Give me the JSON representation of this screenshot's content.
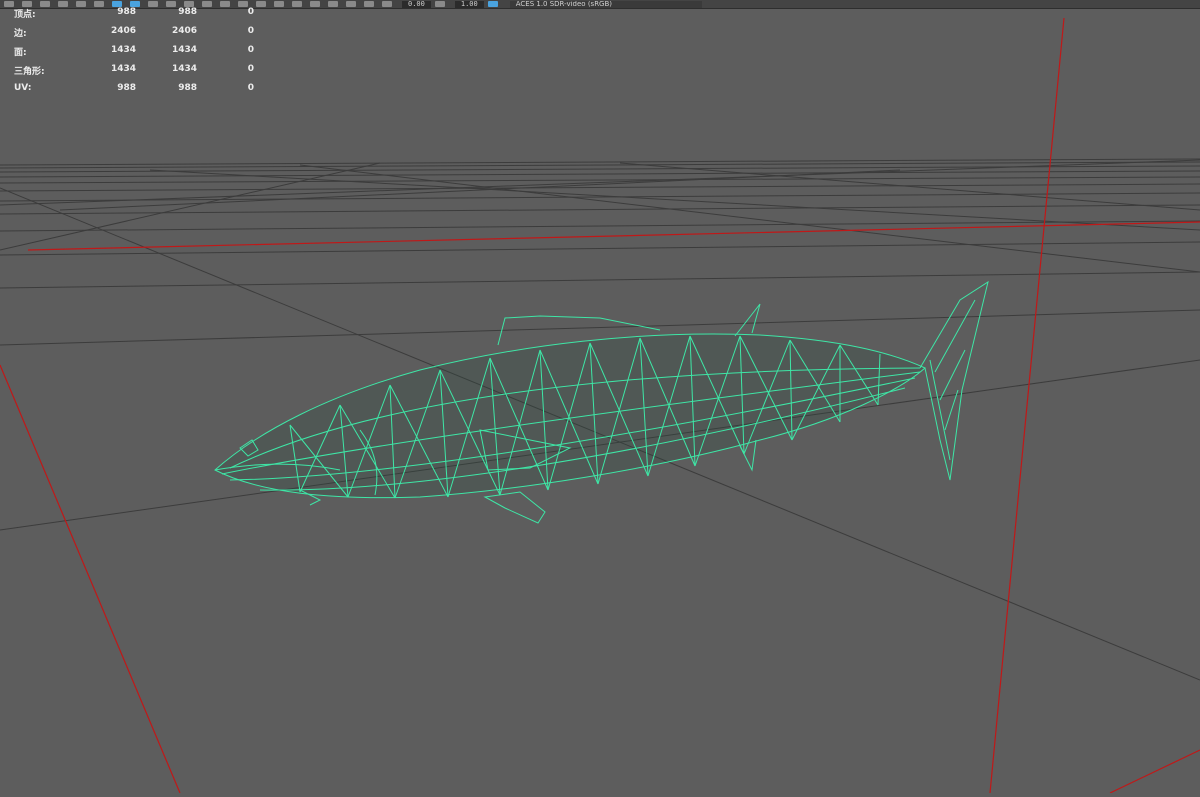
{
  "toolbar": {
    "field_1": "0.00",
    "field_2": "1.00",
    "color_space": "ACES 1.0 SDR-video (sRGB)"
  },
  "hud": {
    "rows": [
      {
        "label": "顶点:",
        "v1": "988",
        "v2": "988",
        "v3": "0"
      },
      {
        "label": "边:",
        "v1": "2406",
        "v2": "2406",
        "v3": "0"
      },
      {
        "label": "面:",
        "v1": "1434",
        "v2": "1434",
        "v3": "0"
      },
      {
        "label": "三角形:",
        "v1": "1434",
        "v2": "1434",
        "v3": "0"
      },
      {
        "label": "UV:",
        "v1": "988",
        "v2": "988",
        "v3": "0"
      }
    ]
  },
  "colors": {
    "viewport_bg": "#5d5d5d",
    "grid": "#3c3c3c",
    "axis": "#c01818",
    "wireframe": "#3ee6a6"
  },
  "icons": [
    "select-icon",
    "move-icon",
    "rotate-icon",
    "scale-icon",
    "snap-icon",
    "camera-icon",
    "grid-icon",
    "shading-icon",
    "light-icon",
    "color-management-icon"
  ]
}
